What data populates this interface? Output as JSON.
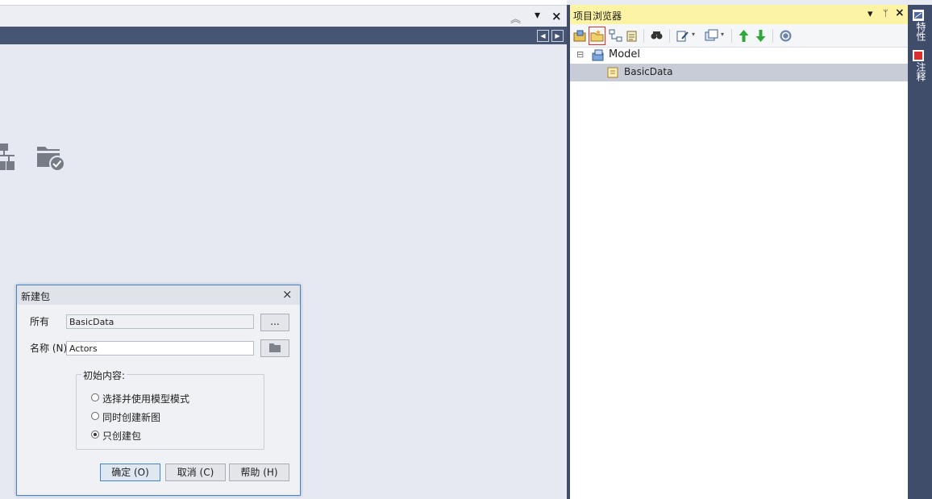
{
  "doc_area": {
    "collapse_glyph": "︽",
    "dropdown_glyph": "▾",
    "close_glyph": "×",
    "nav_prev": "◀",
    "nav_next": "▶"
  },
  "project_browser": {
    "title": "项目浏览器",
    "title_buttons": [
      "▾",
      "ᛘ",
      "×"
    ],
    "toolbar_icons": [
      "new-model-icon",
      "new-package-icon",
      "new-diagram-icon",
      "new-element-icon",
      "find-icon",
      "edit-icon",
      "copy-icon",
      "move-up-icon",
      "move-down-icon",
      "help-icon"
    ],
    "tree": [
      {
        "label": "Model",
        "expander": "⊟",
        "icon": "model-root-icon",
        "selected": false
      },
      {
        "label": "BasicData",
        "icon": "package-icon",
        "selected": true
      }
    ]
  },
  "right_dock": {
    "tabs": [
      "特性",
      "注释"
    ]
  },
  "dialog": {
    "title": "新建包",
    "close_glyph": "×",
    "owner_label": "所有",
    "owner_value": "BasicData",
    "browse_label": "...",
    "name_label": "名称 (N):",
    "name_value": "Actors",
    "group_title": "初始内容:",
    "options": [
      {
        "label": "选择并使用模型模式",
        "checked": false
      },
      {
        "label": "同时创建新图",
        "checked": false
      },
      {
        "label": "只创建包",
        "checked": true
      }
    ],
    "ok_label": "确定 (O)",
    "cancel_label": "取消 (C)",
    "help_label": "帮助 (H)"
  },
  "colors": {
    "accent": "#3f86cb",
    "dock": "#3f4d6b",
    "title_yellow": "#fdf3a4"
  }
}
